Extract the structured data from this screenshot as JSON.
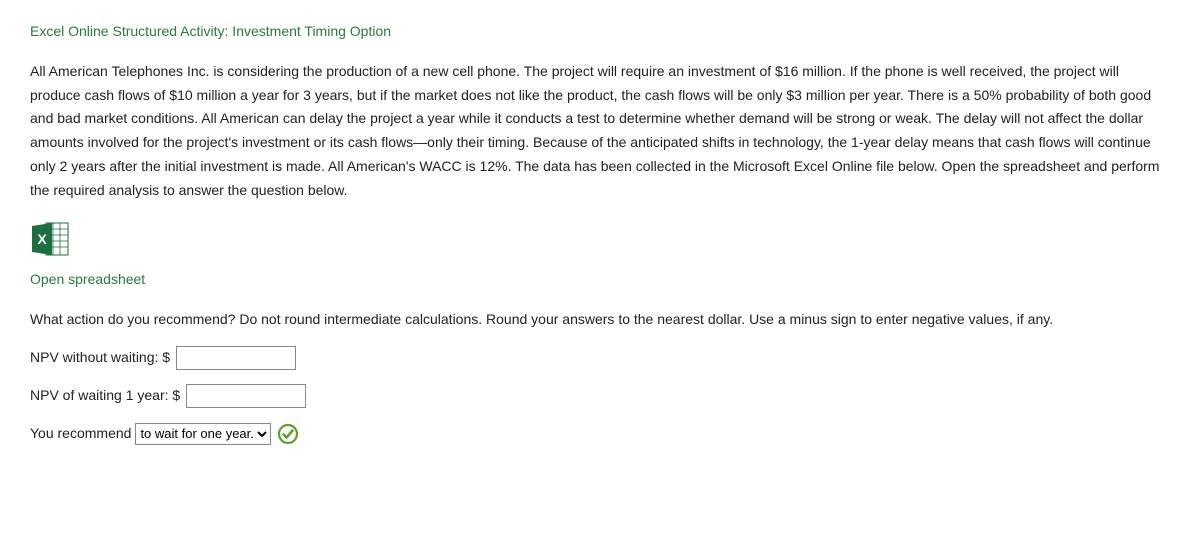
{
  "title": "Excel Online Structured Activity: Investment Timing Option",
  "body_text": "All American Telephones Inc. is considering the production of a new cell phone. The project will require an investment of $16 million. If the phone is well received, the project will produce cash flows of $10 million a year for 3 years, but if the market does not like the product, the cash flows will be only $3 million per year. There is a 50% probability of both good and bad market conditions. All American can delay the project a year while it conducts a test to determine whether demand will be strong or weak. The delay will not affect the dollar amounts involved for the project's investment or its cash flows—only their timing. Because of the anticipated shifts in technology, the 1-year delay means that cash flows will continue only 2 years after the initial investment is made. All American's WACC is 12%. The data has been collected in the Microsoft Excel Online file below. Open the spreadsheet and perform the required analysis to answer the question below.",
  "open_link": "Open spreadsheet",
  "question": "What action do you recommend? Do not round intermediate calculations. Round your answers to the nearest dollar. Use a minus sign to enter negative values, if any.",
  "fields": {
    "npv_without_label": "NPV without waiting: $",
    "npv_without_value": "",
    "npv_waiting_label": "NPV of waiting 1 year: $",
    "npv_waiting_value": "",
    "recommend_label": "You recommend",
    "recommend_selected": "to wait for one year."
  },
  "icons": {
    "excel": "excel-icon",
    "check": "check-icon"
  }
}
